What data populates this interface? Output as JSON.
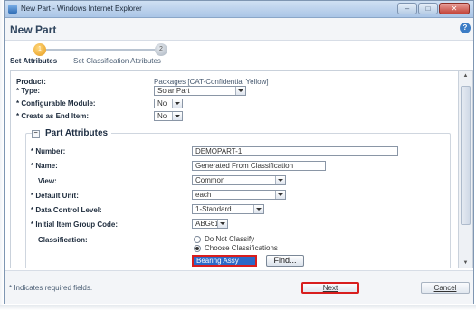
{
  "window": {
    "title": "New Part - Windows Internet Explorer",
    "buttons": {
      "minimize": "–",
      "maximize": "□",
      "close": "✕"
    }
  },
  "header": {
    "title": "New Part",
    "help": "?"
  },
  "steps": [
    {
      "number": "1",
      "label": "Set Attributes"
    },
    {
      "number": "2",
      "label": "Set Classification Attributes"
    }
  ],
  "form": {
    "product_label": "Product:",
    "product_value": "Packages [CAT-Confidential Yellow]",
    "type_label": "* Type:",
    "type_value": "Solar Part",
    "configurable_label": "* Configurable Module:",
    "configurable_value": "No",
    "end_item_label": "* Create as End Item:",
    "end_item_value": "No"
  },
  "part_attributes": {
    "legend": "Part Attributes",
    "toggle": "−",
    "number_label": "* Number:",
    "number_value": "DEMOPART-1",
    "name_label": "* Name:",
    "name_value": "Generated From Classification",
    "view_label": "View:",
    "view_value": "Common",
    "unit_label": "* Default Unit:",
    "unit_value": "each",
    "dcl_label": "* Data Control Level:",
    "dcl_value": "1-Standard",
    "iig_label": "* Initial Item Group Code:",
    "iig_value": "ABG61",
    "classification_label": "Classification:",
    "classification_options": [
      "Do Not Classify",
      "Choose Classifications"
    ],
    "classification_selected": "Choose Classifications",
    "classification_value": "Bearing Assy",
    "find_label": "Find..."
  },
  "footer": {
    "note": "* Indicates required fields.",
    "next_label": "Next",
    "cancel_label": "Cancel"
  },
  "colors": {
    "highlight": "#d81e1e",
    "selection": "#2b69c8",
    "active_step": "#e59a1d"
  }
}
